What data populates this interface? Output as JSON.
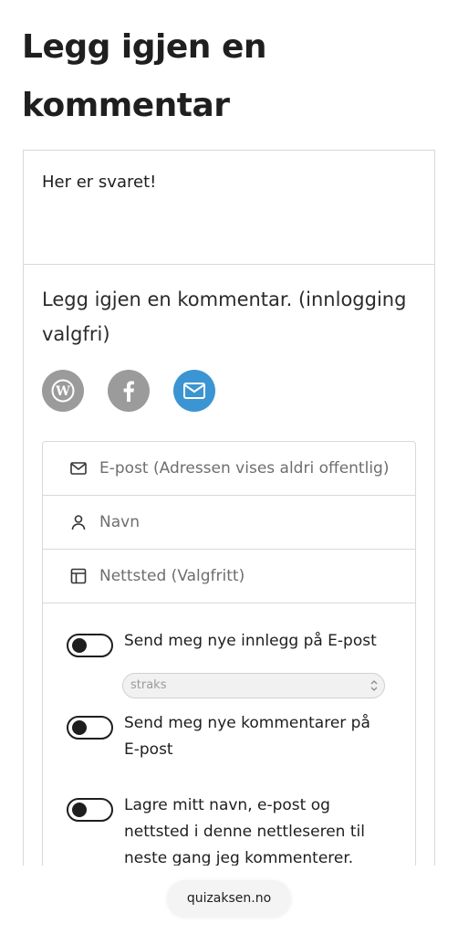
{
  "page_title": "Legg igjen en kommentar",
  "comment": {
    "text": "Her er svaret!",
    "login_prompt": "Legg igjen en kommentar. (innlogging valgfri)"
  },
  "social": [
    {
      "icon": "wordpress-icon",
      "color": "#9b9b9b"
    },
    {
      "icon": "facebook-icon",
      "color": "#9b9b9b"
    },
    {
      "icon": "mail-icon",
      "color": "#3b95d3"
    }
  ],
  "fields": {
    "email_placeholder": "E-post (Adressen vises aldri offentlig)",
    "name_placeholder": "Navn",
    "website_placeholder": "Nettsted (Valgfritt)"
  },
  "options": {
    "new_posts_label": "Send meg nye innlegg på E-post",
    "frequency_selected": "straks",
    "new_comments_label": "Send meg nye kommentarer på E-post",
    "save_info_label": "Lagre mitt navn, e-post og nettsted i denne nettleseren til neste gang jeg kommenterer."
  },
  "browser": {
    "domain": "quizaksen.no"
  }
}
